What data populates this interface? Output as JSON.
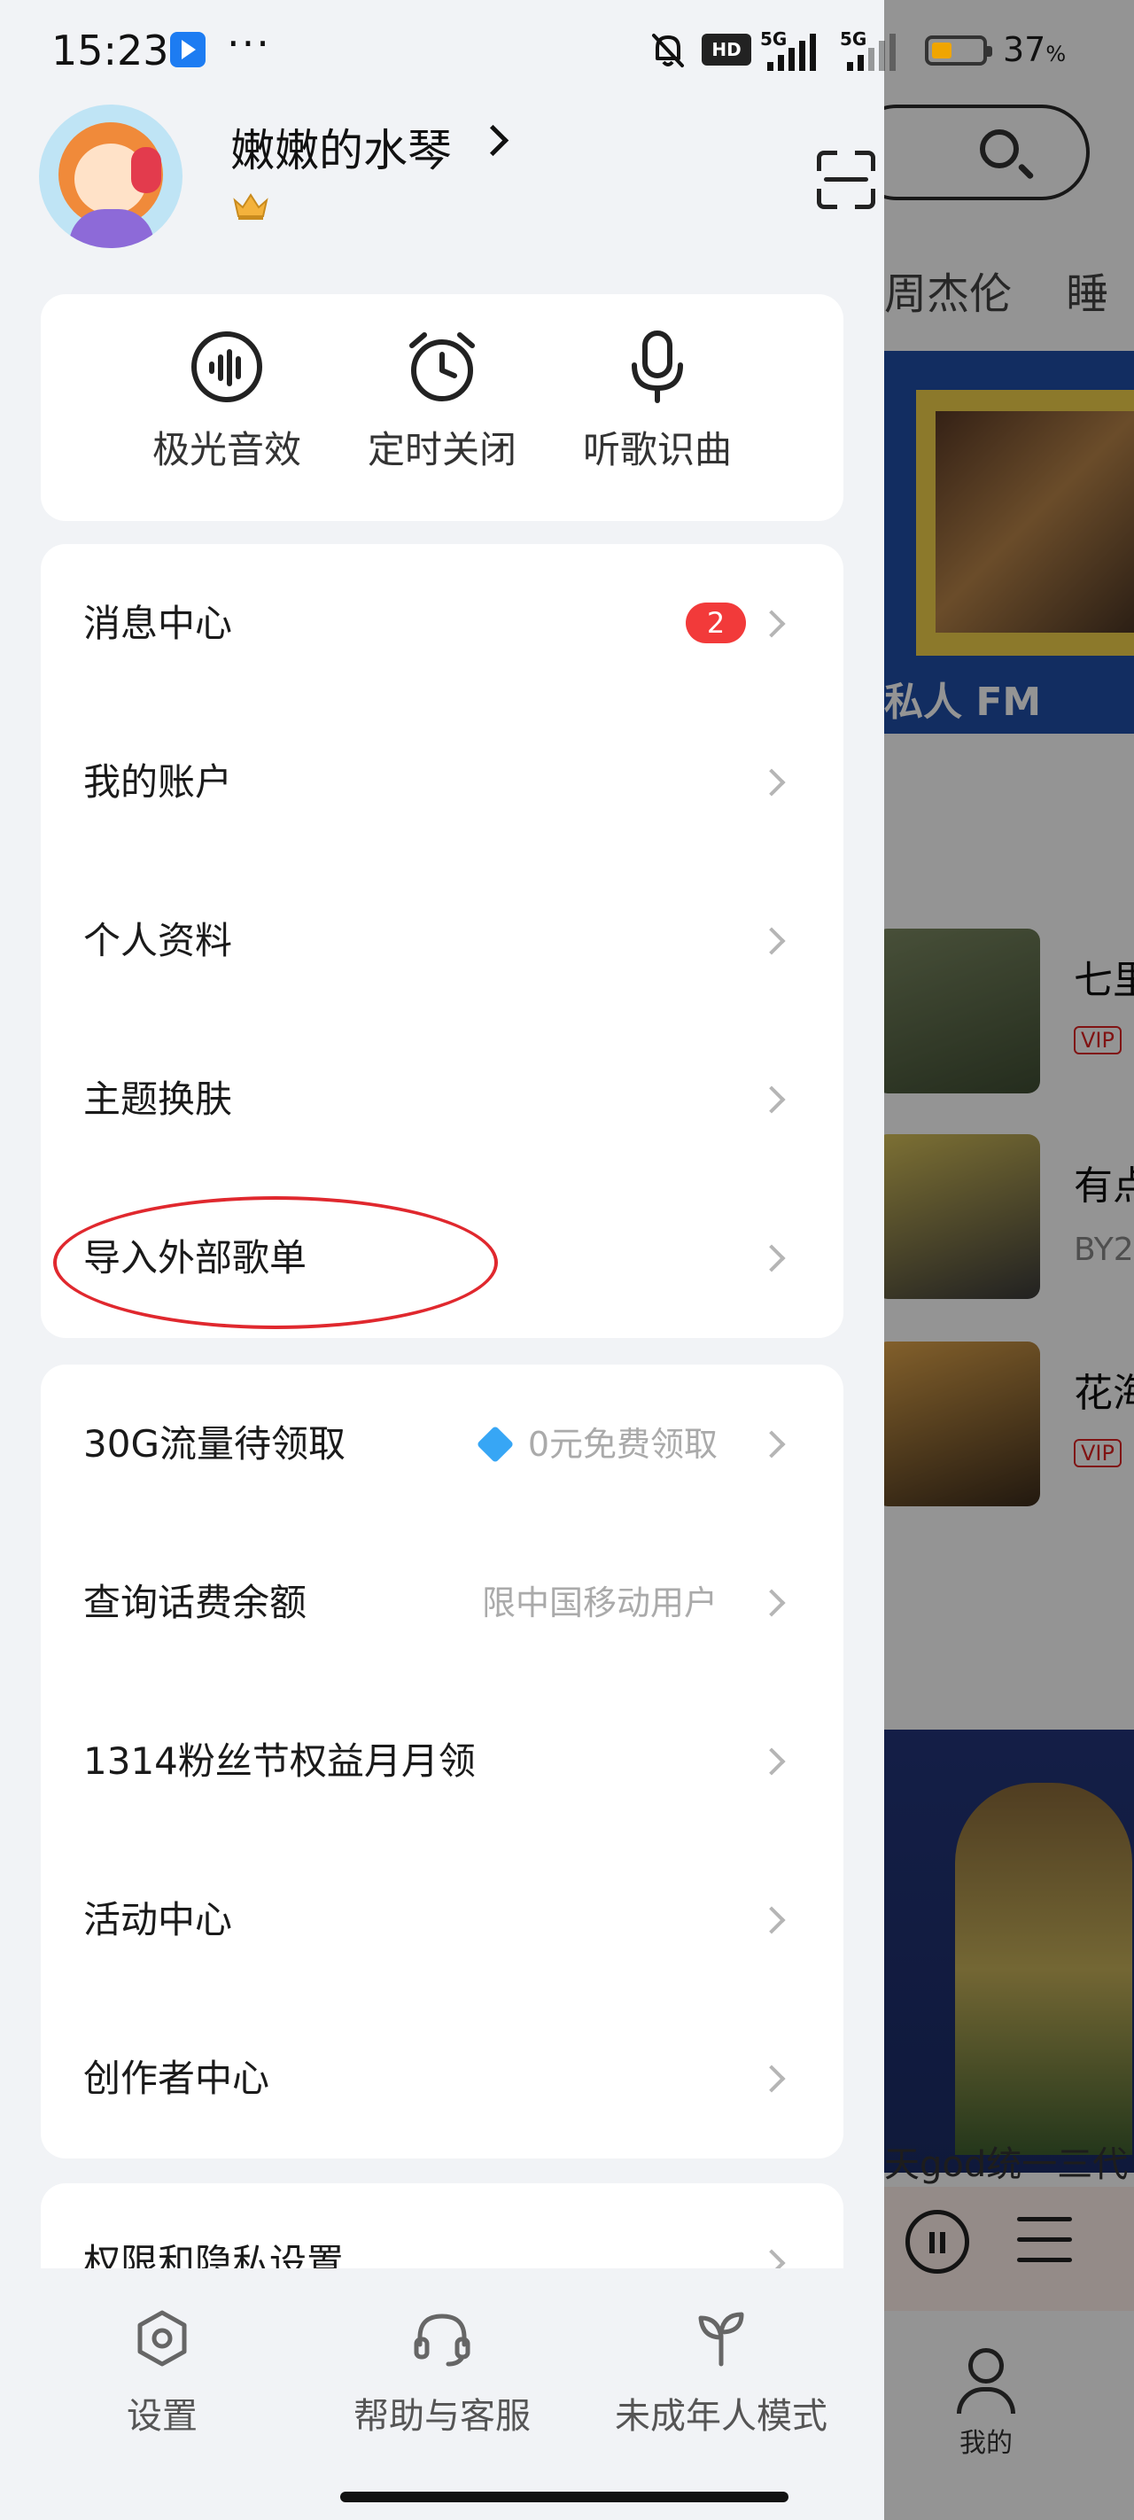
{
  "status_bar": {
    "time": "15:23",
    "more": "···",
    "hd": "HD",
    "network_1": "5G",
    "network_2": "5G",
    "battery_percent": "37",
    "battery_unit": "%"
  },
  "profile": {
    "username": "嫩嫩的水琴"
  },
  "quick_actions": [
    {
      "label": "极光音效",
      "icon": "sound-wave-icon"
    },
    {
      "label": "定时关闭",
      "icon": "alarm-clock-icon"
    },
    {
      "label": "听歌识曲",
      "icon": "microphone-icon"
    }
  ],
  "menu_group_1": [
    {
      "label": "消息中心",
      "badge": "2"
    },
    {
      "label": "我的账户"
    },
    {
      "label": "个人资料"
    },
    {
      "label": "主题换肤"
    },
    {
      "label": "导入外部歌单"
    }
  ],
  "menu_group_2": [
    {
      "label": "30G流量待领取",
      "hint": "0元免费领取"
    },
    {
      "label": "查询话费余额",
      "hint": "限中国移动用户"
    },
    {
      "label": "1314粉丝节权益月月领"
    },
    {
      "label": "活动中心"
    },
    {
      "label": "创作者中心"
    }
  ],
  "menu_group_3": [
    {
      "label": "权限和隐私设置"
    }
  ],
  "bottom_bar": [
    {
      "label": "设置",
      "icon": "settings-icon"
    },
    {
      "label": "帮助与客服",
      "icon": "headset-icon"
    },
    {
      "label": "未成年人模式",
      "icon": "sprout-icon"
    }
  ],
  "background_app": {
    "tab_1": "周杰伦",
    "tab_2": "睡",
    "fm_banner": "私人 FM",
    "songs": [
      {
        "title": "七里",
        "meta": "VIP"
      },
      {
        "title": "有点",
        "meta": "BY2"
      },
      {
        "title": "花海",
        "meta": "VIP"
      }
    ],
    "video_caption": "天god统一三代",
    "nav_me": "我的"
  },
  "colors": {
    "badge": "#f23a3a",
    "highlight_circle": "#e0282e",
    "background": "#f1f3f6"
  }
}
